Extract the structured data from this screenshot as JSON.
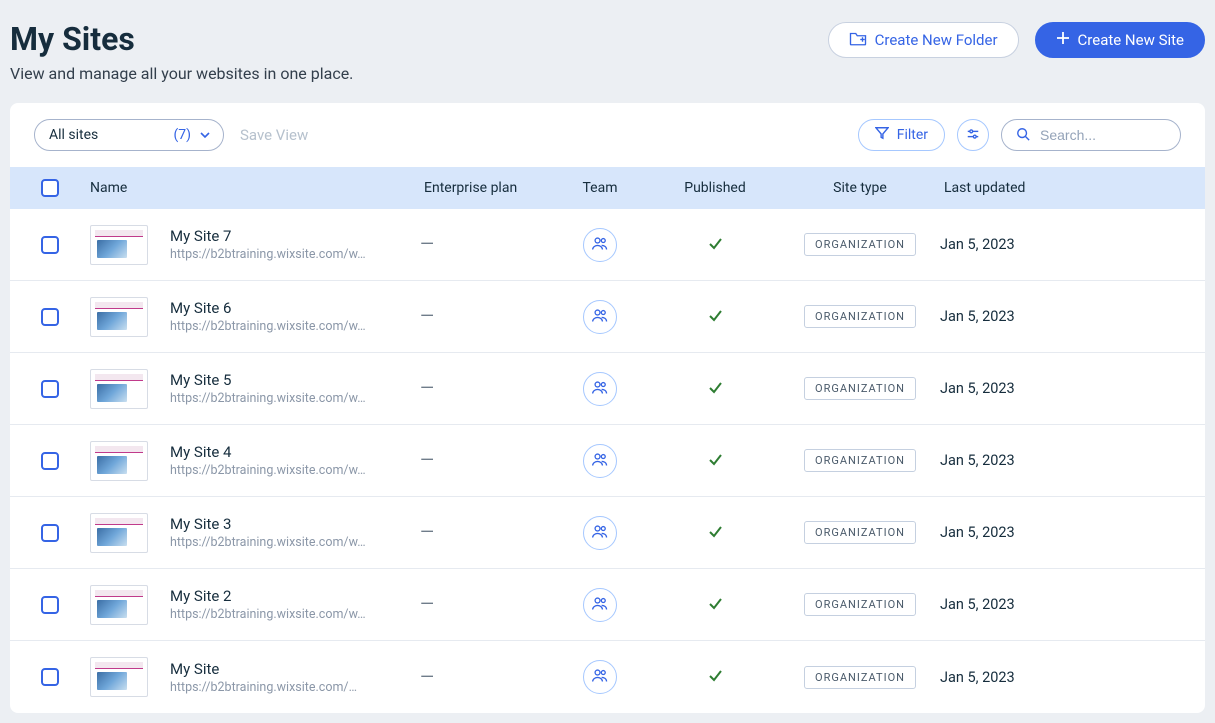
{
  "header": {
    "title": "My Sites",
    "subtitle": "View and manage all your websites in one place.",
    "create_folder_label": "Create New Folder",
    "create_site_label": "Create New Site"
  },
  "toolbar": {
    "dropdown_label": "All sites",
    "dropdown_count": "(7)",
    "save_view_label": "Save View",
    "filter_label": "Filter",
    "search_placeholder": "Search..."
  },
  "columns": {
    "name": "Name",
    "plan": "Enterprise plan",
    "team": "Team",
    "published": "Published",
    "site_type": "Site type",
    "last_updated": "Last updated"
  },
  "type_label": "ORGANIZATION",
  "plan_dash": "—",
  "sites": [
    {
      "title": "My Site 7",
      "url": "https://b2btraining.wixsite.com/w…",
      "date": "Jan 5, 2023"
    },
    {
      "title": "My Site 6",
      "url": "https://b2btraining.wixsite.com/w…",
      "date": "Jan 5, 2023"
    },
    {
      "title": "My Site 5",
      "url": "https://b2btraining.wixsite.com/w…",
      "date": "Jan 5, 2023"
    },
    {
      "title": "My Site 4",
      "url": "https://b2btraining.wixsite.com/w…",
      "date": "Jan 5, 2023"
    },
    {
      "title": "My Site 3",
      "url": "https://b2btraining.wixsite.com/w…",
      "date": "Jan 5, 2023"
    },
    {
      "title": "My Site 2",
      "url": "https://b2btraining.wixsite.com/w…",
      "date": "Jan 5, 2023"
    },
    {
      "title": "My Site",
      "url": "https://b2btraining.wixsite.com/…",
      "date": "Jan 5, 2023"
    }
  ]
}
